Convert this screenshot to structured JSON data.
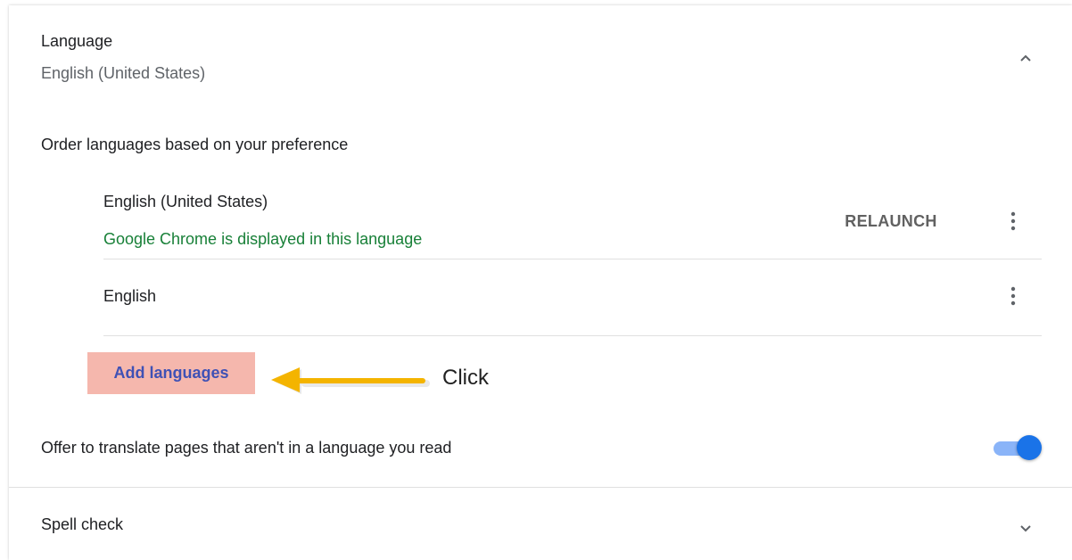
{
  "language_section": {
    "title": "Language",
    "current": "English (United States)",
    "collapse_icon": "chevron-up-icon"
  },
  "order": {
    "label": "Order languages based on your preference",
    "languages": [
      {
        "name": "English (United States)",
        "note": "Google Chrome is displayed in this language",
        "action": "RELAUNCH",
        "menu_icon": "more-vert-icon"
      },
      {
        "name": "English",
        "menu_icon": "more-vert-icon"
      }
    ],
    "add_button": "Add languages"
  },
  "annotation": {
    "arrow_icon": "arrow-left-icon",
    "text": "Click"
  },
  "translate": {
    "label": "Offer to translate pages that aren't in a language you read",
    "enabled": true
  },
  "spell_check": {
    "label": "Spell check",
    "expand_icon": "chevron-down-icon"
  },
  "colors": {
    "note_green": "#188038",
    "add_button_bg": "#f5b7ad",
    "add_button_text": "#3f51b5",
    "arrow": "#f4b400",
    "toggle_on": "#1a73e8",
    "toggle_track": "#8ab4f8"
  }
}
